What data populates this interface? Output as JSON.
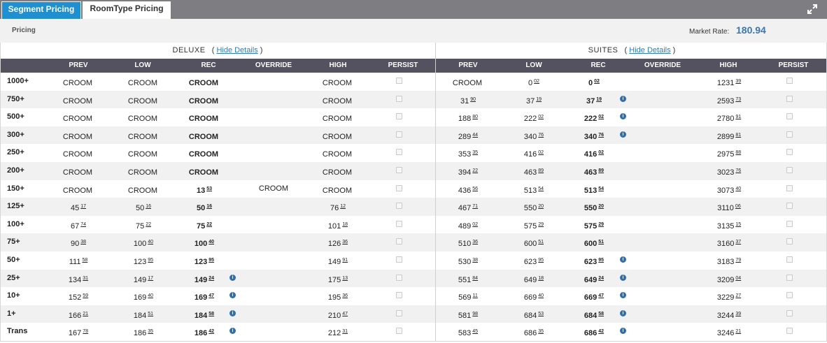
{
  "tabs": {
    "segment": "Segment Pricing",
    "roomtype": "RoomType Pricing"
  },
  "infobar": {
    "pricing": "Pricing",
    "market_label": "Market Rate:",
    "market_value": "180.94"
  },
  "sections": {
    "deluxe": {
      "name": "DELUXE",
      "link": "Hide Details"
    },
    "suites": {
      "name": "SUITES",
      "link": "Hide Details"
    }
  },
  "columns": [
    "PREV",
    "LOW",
    "REC",
    "OVERRIDE",
    "HIGH",
    "PERSIST"
  ],
  "colors": {
    "header_bg": "#55525f",
    "active_tab": "#1e8fd0",
    "info_icon": "#2f6fb0",
    "market_value": "#3a77b3"
  },
  "rows": [
    {
      "label": "1000+",
      "deluxe": {
        "prev": [
          "CROOM",
          ""
        ],
        "low": [
          "CROOM",
          ""
        ],
        "rec": [
          "CROOM",
          ""
        ],
        "override": "",
        "info": false,
        "high": [
          "CROOM",
          ""
        ]
      },
      "suites": {
        "prev": [
          "CROOM",
          ""
        ],
        "low": [
          "0",
          "02"
        ],
        "rec": [
          "0",
          "02"
        ],
        "override": "",
        "info": false,
        "high": [
          "1231",
          "39"
        ]
      }
    },
    {
      "label": "750+",
      "deluxe": {
        "prev": [
          "CROOM",
          ""
        ],
        "low": [
          "CROOM",
          ""
        ],
        "rec": [
          "CROOM",
          ""
        ],
        "override": "",
        "info": false,
        "high": [
          "CROOM",
          ""
        ]
      },
      "suites": {
        "prev": [
          "31",
          "90"
        ],
        "low": [
          "37",
          "19"
        ],
        "rec": [
          "37",
          "19"
        ],
        "override": "",
        "info": true,
        "high": [
          "2593",
          "73"
        ]
      }
    },
    {
      "label": "500+",
      "deluxe": {
        "prev": [
          "CROOM",
          ""
        ],
        "low": [
          "CROOM",
          ""
        ],
        "rec": [
          "CROOM",
          ""
        ],
        "override": "",
        "info": false,
        "high": [
          "CROOM",
          ""
        ]
      },
      "suites": {
        "prev": [
          "188",
          "80"
        ],
        "low": [
          "222",
          "02"
        ],
        "rec": [
          "222",
          "02"
        ],
        "override": "",
        "info": true,
        "high": [
          "2780",
          "91"
        ]
      }
    },
    {
      "label": "300+",
      "deluxe": {
        "prev": [
          "CROOM",
          ""
        ],
        "low": [
          "CROOM",
          ""
        ],
        "rec": [
          "CROOM",
          ""
        ],
        "override": "",
        "info": false,
        "high": [
          "CROOM",
          ""
        ]
      },
      "suites": {
        "prev": [
          "289",
          "44"
        ],
        "low": [
          "340",
          "76"
        ],
        "rec": [
          "340",
          "76"
        ],
        "override": "",
        "info": true,
        "high": [
          "2899",
          "81"
        ]
      }
    },
    {
      "label": "250+",
      "deluxe": {
        "prev": [
          "CROOM",
          ""
        ],
        "low": [
          "CROOM",
          ""
        ],
        "rec": [
          "CROOM",
          ""
        ],
        "override": "",
        "info": false,
        "high": [
          "CROOM",
          ""
        ]
      },
      "suites": {
        "prev": [
          "353",
          "35"
        ],
        "low": [
          "416",
          "02"
        ],
        "rec": [
          "416",
          "02"
        ],
        "override": "",
        "info": false,
        "high": [
          "2975",
          "88"
        ]
      }
    },
    {
      "label": "200+",
      "deluxe": {
        "prev": [
          "CROOM",
          ""
        ],
        "low": [
          "CROOM",
          ""
        ],
        "rec": [
          "CROOM",
          ""
        ],
        "override": "",
        "info": false,
        "high": [
          "CROOM",
          ""
        ]
      },
      "suites": {
        "prev": [
          "394",
          "22"
        ],
        "low": [
          "463",
          "89"
        ],
        "rec": [
          "463",
          "89"
        ],
        "override": "",
        "info": false,
        "high": [
          "3023",
          "76"
        ]
      }
    },
    {
      "label": "150+",
      "deluxe": {
        "prev": [
          "CROOM",
          ""
        ],
        "low": [
          "CROOM",
          ""
        ],
        "rec": [
          "13",
          "53"
        ],
        "override": "CROOM",
        "info": false,
        "high": [
          "CROOM",
          ""
        ]
      },
      "suites": {
        "prev": [
          "436",
          "56"
        ],
        "low": [
          "513",
          "54"
        ],
        "rec": [
          "513",
          "54"
        ],
        "override": "",
        "info": false,
        "high": [
          "3073",
          "40"
        ]
      }
    },
    {
      "label": "125+",
      "deluxe": {
        "prev": [
          "45",
          "17"
        ],
        "low": [
          "50",
          "16"
        ],
        "rec": [
          "50",
          "16"
        ],
        "override": "",
        "info": false,
        "high": [
          "76",
          "12"
        ]
      },
      "suites": {
        "prev": [
          "467",
          "71"
        ],
        "low": [
          "550",
          "20"
        ],
        "rec": [
          "550",
          "20"
        ],
        "override": "",
        "info": false,
        "high": [
          "3110",
          "06"
        ]
      }
    },
    {
      "label": "100+",
      "deluxe": {
        "prev": [
          "67",
          "74"
        ],
        "low": [
          "75",
          "22"
        ],
        "rec": [
          "75",
          "22"
        ],
        "override": "",
        "info": false,
        "high": [
          "101",
          "18"
        ]
      },
      "suites": {
        "prev": [
          "489",
          "02"
        ],
        "low": [
          "575",
          "29"
        ],
        "rec": [
          "575",
          "29"
        ],
        "override": "",
        "info": false,
        "high": [
          "3135",
          "15"
        ]
      }
    },
    {
      "label": "75+",
      "deluxe": {
        "prev": [
          "90",
          "38"
        ],
        "low": [
          "100",
          "40"
        ],
        "rec": [
          "100",
          "40"
        ],
        "override": "",
        "info": false,
        "high": [
          "126",
          "36"
        ]
      },
      "suites": {
        "prev": [
          "510",
          "36"
        ],
        "low": [
          "600",
          "51"
        ],
        "rec": [
          "600",
          "51"
        ],
        "override": "",
        "info": false,
        "high": [
          "3160",
          "37"
        ]
      }
    },
    {
      "label": "50+",
      "deluxe": {
        "prev": [
          "111",
          "58"
        ],
        "low": [
          "123",
          "95"
        ],
        "rec": [
          "123",
          "95"
        ],
        "override": "",
        "info": false,
        "high": [
          "149",
          "91"
        ]
      },
      "suites": {
        "prev": [
          "530",
          "38"
        ],
        "low": [
          "623",
          "95"
        ],
        "rec": [
          "623",
          "95"
        ],
        "override": "",
        "info": true,
        "high": [
          "3183",
          "79"
        ]
      }
    },
    {
      "label": "25+",
      "deluxe": {
        "prev": [
          "134",
          "31"
        ],
        "low": [
          "149",
          "17"
        ],
        "rec": [
          "149",
          "24"
        ],
        "override": "",
        "info": true,
        "high": [
          "175",
          "13"
        ]
      },
      "suites": {
        "prev": [
          "551",
          "84"
        ],
        "low": [
          "649",
          "18"
        ],
        "rec": [
          "649",
          "24"
        ],
        "override": "",
        "info": true,
        "high": [
          "3209",
          "04"
        ]
      }
    },
    {
      "label": "10+",
      "deluxe": {
        "prev": [
          "152",
          "59"
        ],
        "low": [
          "169",
          "40"
        ],
        "rec": [
          "169",
          "47"
        ],
        "override": "",
        "info": true,
        "high": [
          "195",
          "36"
        ]
      },
      "suites": {
        "prev": [
          "569",
          "11"
        ],
        "low": [
          "669",
          "40"
        ],
        "rec": [
          "669",
          "47"
        ],
        "override": "",
        "info": true,
        "high": [
          "3229",
          "27"
        ]
      }
    },
    {
      "label": "1+",
      "deluxe": {
        "prev": [
          "166",
          "21"
        ],
        "low": [
          "184",
          "51"
        ],
        "rec": [
          "184",
          "58"
        ],
        "override": "",
        "info": true,
        "high": [
          "210",
          "47"
        ]
      },
      "suites": {
        "prev": [
          "581",
          "98"
        ],
        "low": [
          "684",
          "53"
        ],
        "rec": [
          "684",
          "58"
        ],
        "override": "",
        "info": true,
        "high": [
          "3244",
          "39"
        ]
      }
    },
    {
      "label": "Trans",
      "deluxe": {
        "prev": [
          "167",
          "78"
        ],
        "low": [
          "186",
          "35"
        ],
        "rec": [
          "186",
          "42"
        ],
        "override": "",
        "info": true,
        "high": [
          "212",
          "31"
        ]
      },
      "suites": {
        "prev": [
          "583",
          "45"
        ],
        "low": [
          "686",
          "35"
        ],
        "rec": [
          "686",
          "42"
        ],
        "override": "",
        "info": true,
        "high": [
          "3246",
          "21"
        ]
      }
    }
  ]
}
